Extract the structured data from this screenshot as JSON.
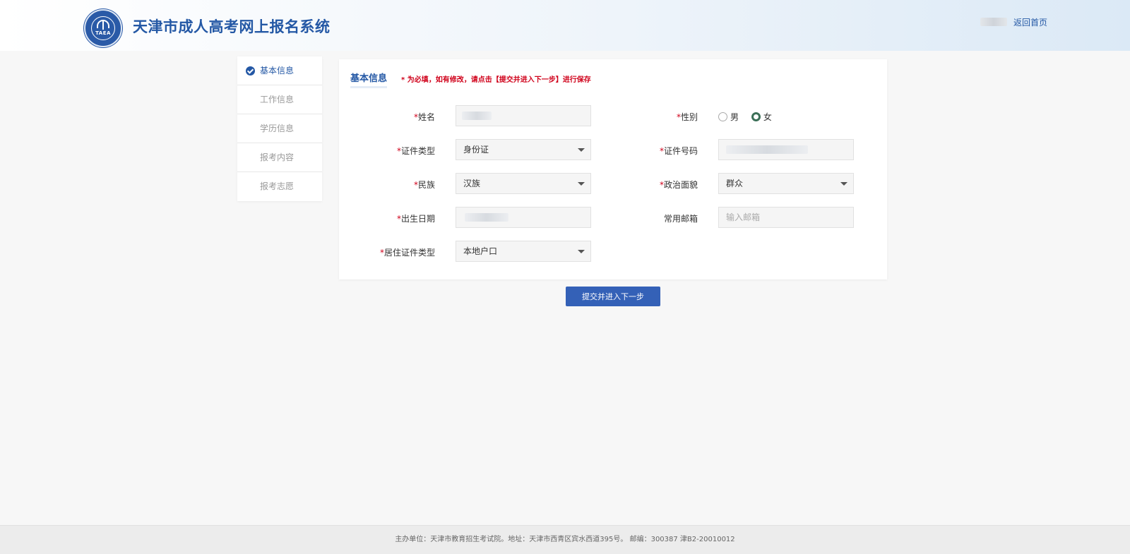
{
  "header": {
    "title": "天津市成人高考网上报名系统",
    "logo_text": "TAEA",
    "home_link": "返回首页"
  },
  "sidenav": {
    "items": [
      {
        "label": "基本信息",
        "active": true
      },
      {
        "label": "工作信息",
        "active": false
      },
      {
        "label": "学历信息",
        "active": false
      },
      {
        "label": "报考内容",
        "active": false
      },
      {
        "label": "报考志愿",
        "active": false
      }
    ]
  },
  "form": {
    "title": "基本信息",
    "note": "* 为必填，如有修改，请点击【提交并进入下一步】进行保存",
    "required_mark": "*",
    "name_label": "姓名",
    "gender_label": "性别",
    "gender_options": [
      "男",
      "女"
    ],
    "gender_selected": "女",
    "id_type_label": "证件类型",
    "id_type_value": "身份证",
    "id_number_label": "证件号码",
    "ethnicity_label": "民族",
    "ethnicity_value": "汉族",
    "political_label": "政治面貌",
    "political_value": "群众",
    "birthdate_label": "出生日期",
    "email_label": "常用邮箱",
    "email_placeholder": "输入邮箱",
    "residence_label": "居住证件类型",
    "residence_value": "本地户口"
  },
  "actions": {
    "submit_label": "提交并进入下一步"
  },
  "footer": {
    "text": "主办单位：天津市教育招生考试院。地址：天津市西青区宾水西道395号。 邮编：300387 津B2-20010012"
  },
  "colors": {
    "brand_blue": "#2458a5",
    "button_blue": "#3461b7",
    "required_red": "#d0021b"
  }
}
